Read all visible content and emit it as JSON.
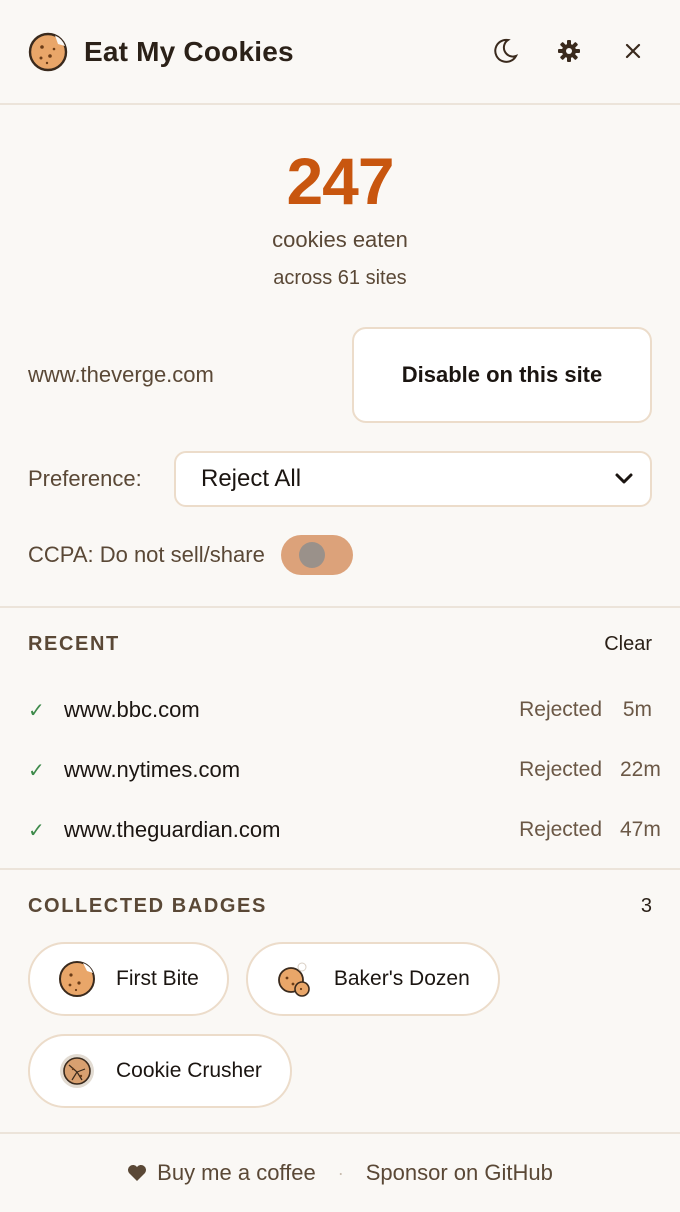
{
  "header": {
    "title": "Eat My Cookies",
    "icons": [
      "cookie-logo-icon",
      "moon-icon",
      "gear-icon",
      "close-icon"
    ]
  },
  "stats": {
    "count": "247",
    "count_label": "cookies eaten",
    "sites_label": "across 61 sites"
  },
  "site": {
    "domain": "www.theverge.com",
    "disable_label": "Disable on this site"
  },
  "preference": {
    "label": "Preference:",
    "selected": "Reject All"
  },
  "ccpa": {
    "label": "CCPA: Do not sell/share",
    "enabled": false
  },
  "recent": {
    "title": "RECENT",
    "clear_label": "Clear",
    "items": [
      {
        "domain": "www.bbc.com",
        "status": "Rejected",
        "time": "5m"
      },
      {
        "domain": "www.nytimes.com",
        "status": "Rejected",
        "time": "22m"
      },
      {
        "domain": "www.theguardian.com",
        "status": "Rejected",
        "time": "47m"
      }
    ]
  },
  "badges": {
    "title": "COLLECTED BADGES",
    "count": "3",
    "items": [
      {
        "label": "First Bite",
        "icon": "cookie-bite-icon"
      },
      {
        "label": "Baker's Dozen",
        "icon": "cookies-stack-icon"
      },
      {
        "label": "Cookie Crusher",
        "icon": "cookie-crushed-icon"
      }
    ]
  },
  "footer": {
    "coffee_label": "Buy me a coffee",
    "sponsor_label": "Sponsor on GitHub"
  },
  "colors": {
    "accent": "#c8560f",
    "background": "#faf8f5",
    "toggle": "#dca27a",
    "check": "#3d8a4a"
  }
}
